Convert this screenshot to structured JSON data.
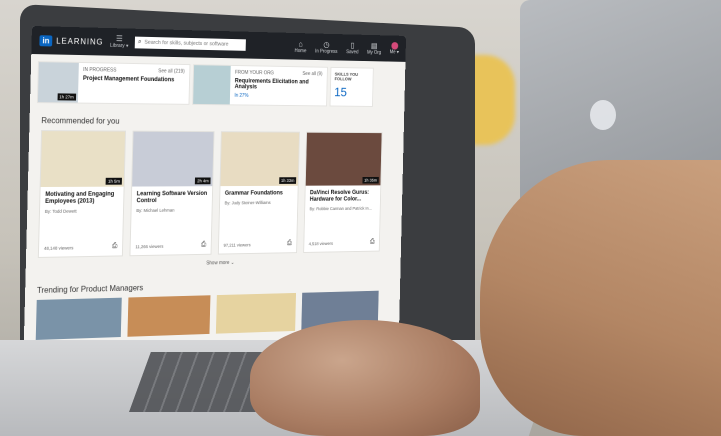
{
  "header": {
    "logo_box": "in",
    "logo_text": "LEARNING",
    "library_label": "Library ▾",
    "search_placeholder": "Search for skills, subjects or software",
    "nav": [
      {
        "label": "Home",
        "icon": "home-icon",
        "glyph": "⌂"
      },
      {
        "label": "In Progress",
        "icon": "clock-icon",
        "glyph": "◷"
      },
      {
        "label": "Saved",
        "icon": "bookmark-icon",
        "glyph": "▯"
      },
      {
        "label": "My Org",
        "icon": "org-icon",
        "glyph": "▤"
      },
      {
        "label": "Me ▾",
        "icon": "avatar",
        "glyph": ""
      }
    ]
  },
  "in_progress": {
    "badge": "IN PROGRESS",
    "counter": "See all (219)",
    "title": "Project Management Foundations",
    "duration": "1h 27m"
  },
  "from_org": {
    "badge": "FROM YOUR ORG",
    "counter": "See all (9)",
    "title": "Requirements Elicitation and Analysis",
    "progress": "In 27%"
  },
  "skills": {
    "label": "SKILLS YOU FOLLOW",
    "count": "15"
  },
  "recommended": {
    "title": "Recommended for you",
    "cards": [
      {
        "duration": "1h 5m",
        "title": "Motivating and Engaging Employees (2013)",
        "author": "By: Todd Dewett",
        "viewers": "48,148 viewers",
        "color": "#e9e0c6"
      },
      {
        "duration": "2h 4m",
        "title": "Learning Software Version Control",
        "author": "By: Michael Lehman",
        "viewers": "11,266 viewers",
        "color": "#c8ccd7"
      },
      {
        "duration": "1h 33m",
        "title": "Grammar Foundations",
        "author": "By: Judy Steiner-Williams",
        "viewers": "97,211 viewers",
        "color": "#e8dcc2"
      },
      {
        "duration": "1h 35m",
        "title": "DaVinci Resolve Gurus: Hardware for Color...",
        "author": "By: Robbie Carman and Patrick In...",
        "viewers": "4,518 viewers",
        "color": "#6b4a3e"
      }
    ],
    "show_more": "Show more ⌄"
  },
  "trending": {
    "title": "Trending for Product Managers",
    "colors": [
      "#7a93a8",
      "#c78d57",
      "#e6d3a0",
      "#6f7f96"
    ]
  },
  "colors": {
    "accent": "#0a66c2",
    "topbar": "#1f2227"
  }
}
